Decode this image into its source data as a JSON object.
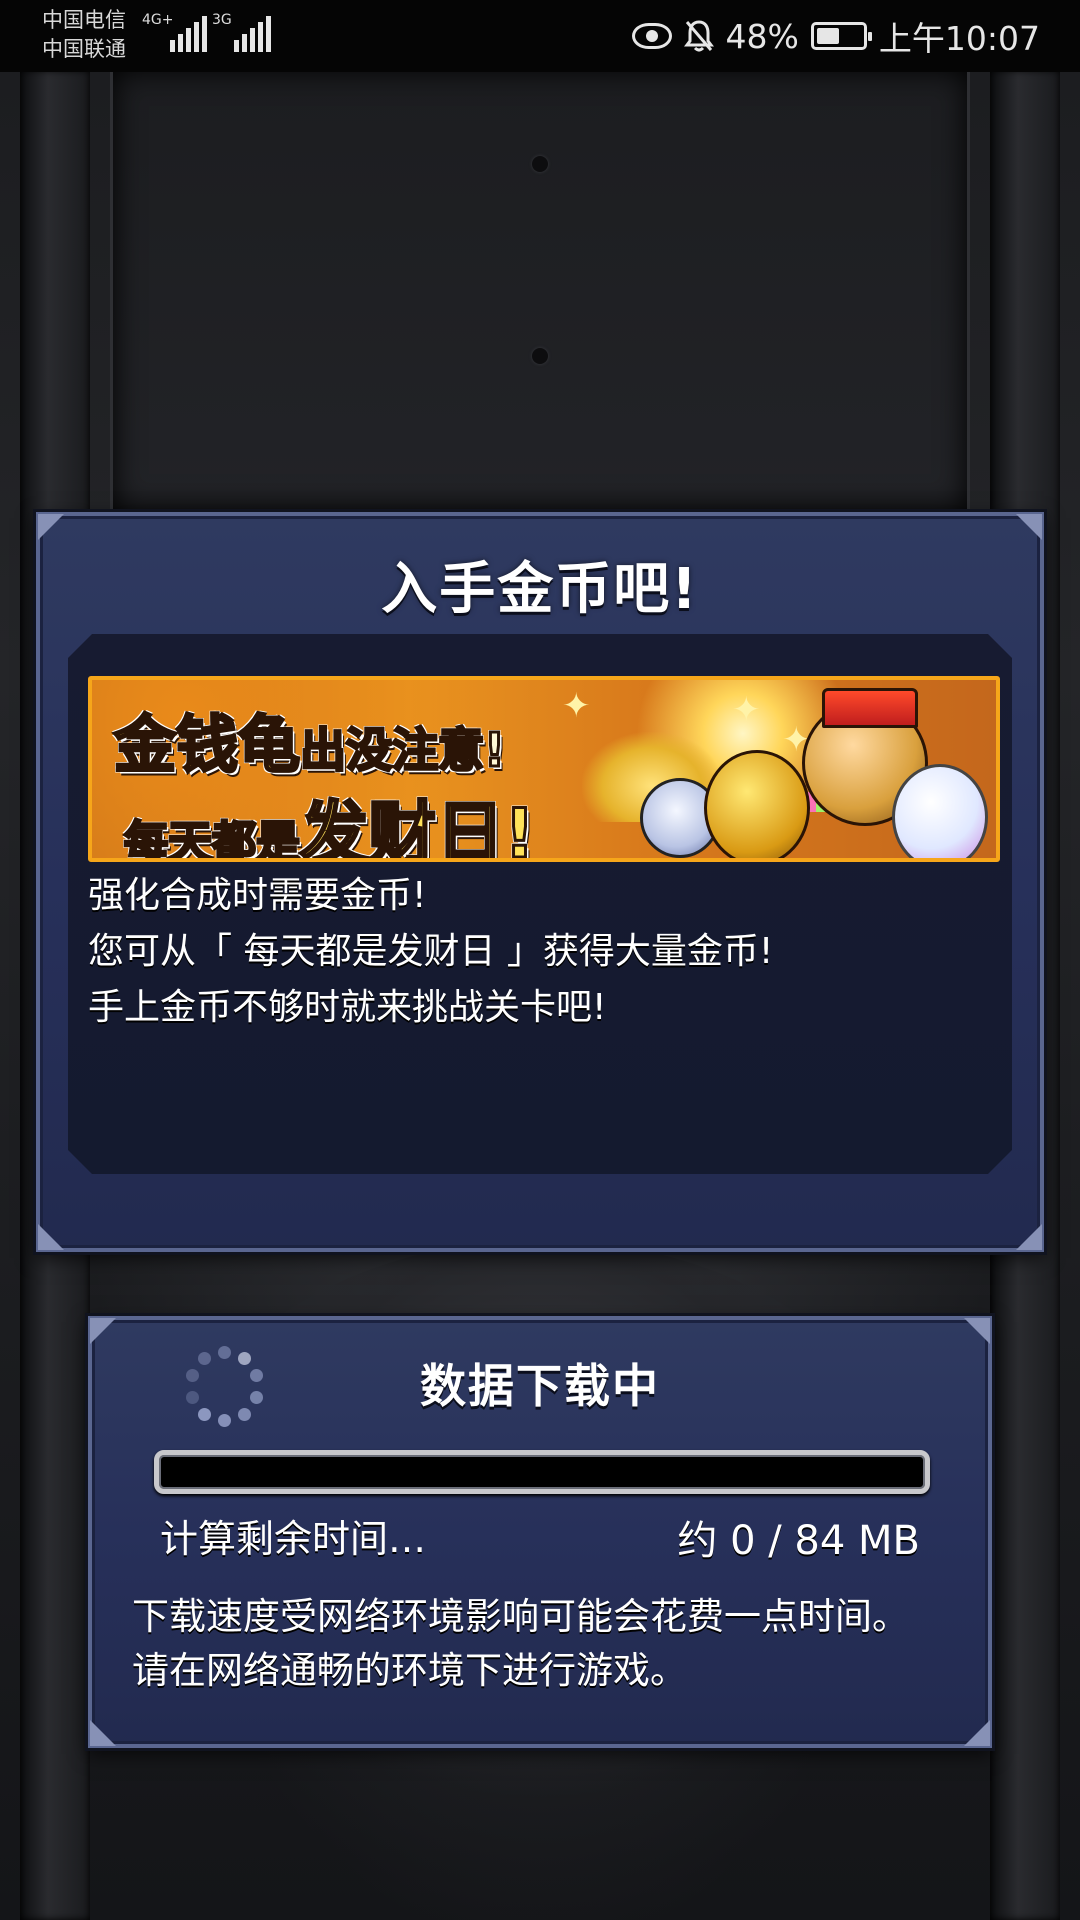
{
  "status_bar": {
    "carrier_1": "中国电信",
    "carrier_2": "中国联通",
    "network_1": "4G+",
    "network_2": "3G",
    "battery": "48%",
    "time": "上午10:07"
  },
  "promo": {
    "title": "入手金币吧!",
    "banner": {
      "line1_main": "金钱龟",
      "line1_sub": "出没注意!",
      "line2_sub": "每天都是",
      "line2_main": "发财日!"
    },
    "description": [
      "强化合成时需要金币!",
      "您可从「 每天都是发财日 」获得大量金币!",
      "手上金币不够时就来挑战关卡吧!"
    ]
  },
  "download": {
    "title": "数据下载中",
    "progress": 0,
    "status": "计算剩余时间…",
    "size": "约 0 / 84 MB",
    "notice": [
      "下载速度受网络环境影响可能会花费一点时间。",
      "请在网络通畅的环境下进行游戏。"
    ]
  },
  "colors": {
    "panel": "#27305a",
    "panel_border": "#5a6690",
    "banner_border": "#f6a61a",
    "progress_track": "#000000"
  },
  "icons": [
    "eye-icon",
    "bell-off-icon",
    "battery-icon",
    "loading-spinner-icon"
  ]
}
